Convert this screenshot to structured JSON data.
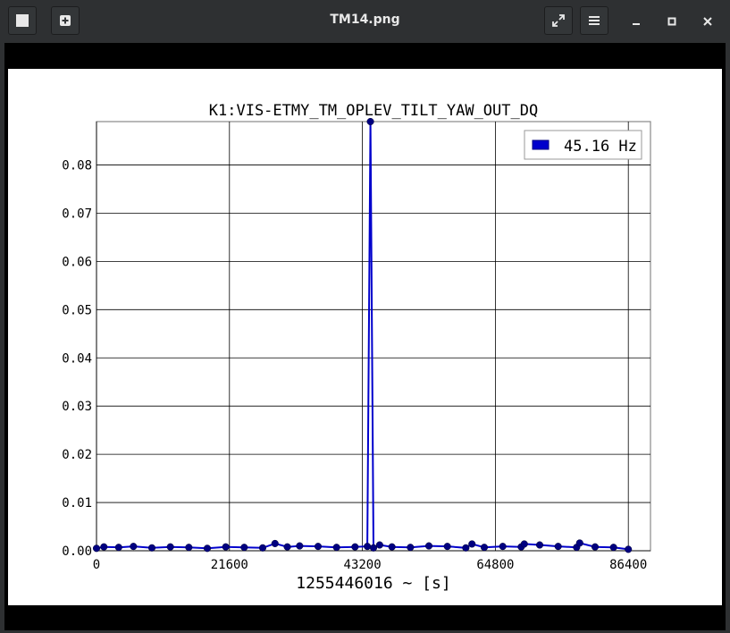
{
  "window": {
    "title": "TM14.png",
    "icons": {
      "new_window": "window-icon",
      "add": "add-icon",
      "fullscreen": "fullscreen-icon",
      "menu": "hamburger-menu-icon",
      "minimize": "minimize-icon",
      "maximize": "maximize-icon",
      "close": "close-icon"
    }
  },
  "chart_data": {
    "type": "line",
    "title": "K1:VIS-ETMY_TM_OPLEV_TILT_YAW_OUT_DQ",
    "xlabel": "1255446016 ~ [s]",
    "ylabel": "",
    "xlim": [
      0,
      90000
    ],
    "ylim": [
      0,
      0.089
    ],
    "xticks": [
      0,
      21600,
      43200,
      64800,
      86400
    ],
    "yticks": [
      "0.00",
      "0.01",
      "0.02",
      "0.03",
      "0.04",
      "0.05",
      "0.06",
      "0.07",
      "0.08"
    ],
    "grid": true,
    "legend_position": "top-right",
    "series": [
      {
        "name": "45.16 Hz",
        "color": "#0000cc",
        "marker_color": "#000080",
        "x": [
          0,
          1200,
          3600,
          6000,
          9000,
          12000,
          15000,
          18000,
          21000,
          24000,
          27000,
          29000,
          31000,
          33000,
          36000,
          39000,
          42000,
          44000,
          44500,
          45000,
          46000,
          48000,
          51000,
          54000,
          57000,
          60000,
          61000,
          63000,
          66000,
          69000,
          69500,
          72000,
          75000,
          78000,
          78500,
          81000,
          84000,
          86400
        ],
        "values": [
          0.0005,
          0.0008,
          0.0007,
          0.0009,
          0.0006,
          0.0008,
          0.0007,
          0.0005,
          0.0008,
          0.0007,
          0.0006,
          0.0015,
          0.0008,
          0.001,
          0.0009,
          0.0007,
          0.0008,
          0.0009,
          0.089,
          0.0006,
          0.0012,
          0.0008,
          0.0007,
          0.001,
          0.0009,
          0.0006,
          0.0014,
          0.0007,
          0.0009,
          0.0008,
          0.0014,
          0.0012,
          0.0009,
          0.0007,
          0.0016,
          0.0008,
          0.0007,
          0.0003
        ]
      }
    ]
  }
}
